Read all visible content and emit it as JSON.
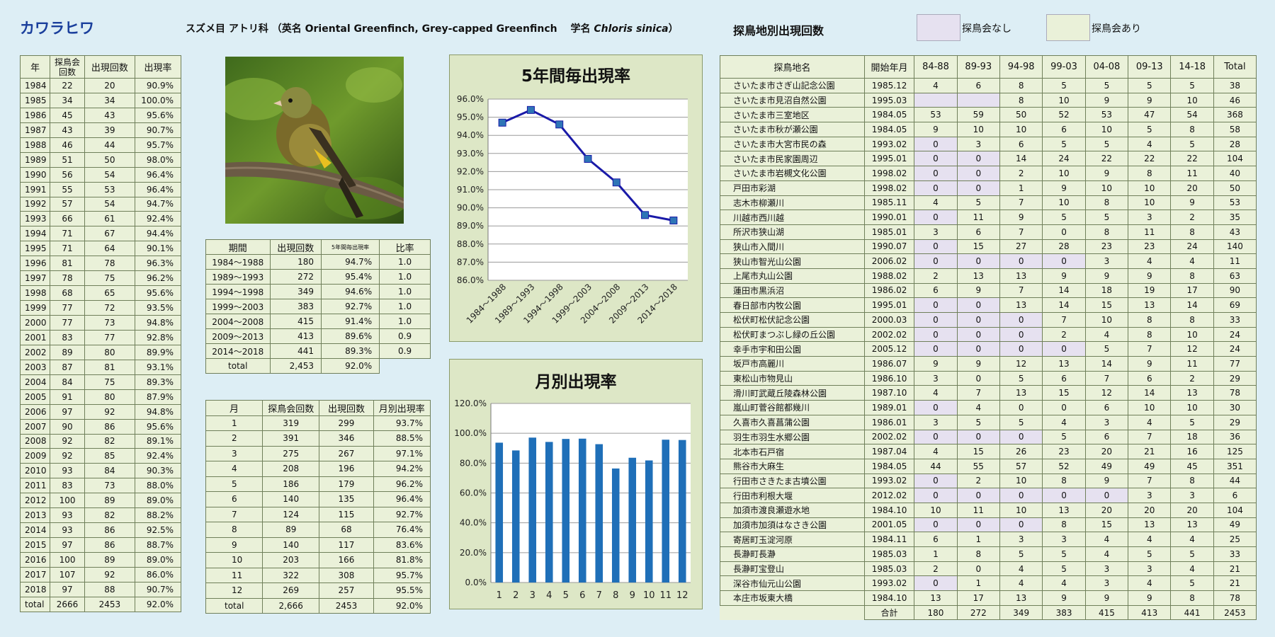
{
  "header": {
    "title": "カワラヒワ",
    "subtitle_pre": "スズメ目 アトリ科 （英名 Oriental Greenfinch, Grey-capped Greenfinch　 学名 ",
    "subtitle_sci": "Chloris sinica",
    "subtitle_post": "）",
    "sites_title": "探鳥地別出現回数",
    "legend_none": "探鳥会なし",
    "legend_some": "探鳥会あり"
  },
  "colors": {
    "no_meeting": "#e6e1f0",
    "meeting": "#eaf1d9",
    "line": "#1a1aa8",
    "marker": "#2e75b6",
    "bar": "#1f6fb8"
  },
  "year_table": {
    "headers": [
      "年",
      "探鳥会回数",
      "出現回数",
      "出現率"
    ],
    "rows": [
      [
        "1984",
        "22",
        "20",
        "90.9%"
      ],
      [
        "1985",
        "34",
        "34",
        "100.0%"
      ],
      [
        "1986",
        "45",
        "43",
        "95.6%"
      ],
      [
        "1987",
        "43",
        "39",
        "90.7%"
      ],
      [
        "1988",
        "46",
        "44",
        "95.7%"
      ],
      [
        "1989",
        "51",
        "50",
        "98.0%"
      ],
      [
        "1990",
        "56",
        "54",
        "96.4%"
      ],
      [
        "1991",
        "55",
        "53",
        "96.4%"
      ],
      [
        "1992",
        "57",
        "54",
        "94.7%"
      ],
      [
        "1993",
        "66",
        "61",
        "92.4%"
      ],
      [
        "1994",
        "71",
        "67",
        "94.4%"
      ],
      [
        "1995",
        "71",
        "64",
        "90.1%"
      ],
      [
        "1996",
        "81",
        "78",
        "96.3%"
      ],
      [
        "1997",
        "78",
        "75",
        "96.2%"
      ],
      [
        "1998",
        "68",
        "65",
        "95.6%"
      ],
      [
        "1999",
        "77",
        "72",
        "93.5%"
      ],
      [
        "2000",
        "77",
        "73",
        "94.8%"
      ],
      [
        "2001",
        "83",
        "77",
        "92.8%"
      ],
      [
        "2002",
        "89",
        "80",
        "89.9%"
      ],
      [
        "2003",
        "87",
        "81",
        "93.1%"
      ],
      [
        "2004",
        "84",
        "75",
        "89.3%"
      ],
      [
        "2005",
        "91",
        "80",
        "87.9%"
      ],
      [
        "2006",
        "97",
        "92",
        "94.8%"
      ],
      [
        "2007",
        "90",
        "86",
        "95.6%"
      ],
      [
        "2008",
        "92",
        "82",
        "89.1%"
      ],
      [
        "2009",
        "92",
        "85",
        "92.4%"
      ],
      [
        "2010",
        "93",
        "84",
        "90.3%"
      ],
      [
        "2011",
        "83",
        "73",
        "88.0%"
      ],
      [
        "2012",
        "100",
        "89",
        "89.0%"
      ],
      [
        "2013",
        "93",
        "82",
        "88.2%"
      ],
      [
        "2014",
        "93",
        "86",
        "92.5%"
      ],
      [
        "2015",
        "97",
        "86",
        "88.7%"
      ],
      [
        "2016",
        "100",
        "89",
        "89.0%"
      ],
      [
        "2017",
        "107",
        "92",
        "86.0%"
      ],
      [
        "2018",
        "97",
        "88",
        "90.7%"
      ],
      [
        "total",
        "2666",
        "2453",
        "92.0%"
      ]
    ]
  },
  "period_table": {
    "headers": [
      "期間",
      "出現回数",
      "5年間毎出現率",
      "比率"
    ],
    "rows": [
      [
        "1984～1988",
        "180",
        "94.7%",
        "1.0"
      ],
      [
        "1989～1993",
        "272",
        "95.4%",
        "1.0"
      ],
      [
        "1994～1998",
        "349",
        "94.6%",
        "1.0"
      ],
      [
        "1999～2003",
        "383",
        "92.7%",
        "1.0"
      ],
      [
        "2004～2008",
        "415",
        "91.4%",
        "1.0"
      ],
      [
        "2009～2013",
        "413",
        "89.6%",
        "0.9"
      ],
      [
        "2014～2018",
        "441",
        "89.3%",
        "0.9"
      ]
    ],
    "total": [
      "total",
      "2,453",
      "92.0%"
    ]
  },
  "month_table": {
    "headers": [
      "月",
      "探鳥会回数",
      "出現回数",
      "月別出現率"
    ],
    "rows": [
      [
        "1",
        "319",
        "299",
        "93.7%"
      ],
      [
        "2",
        "391",
        "346",
        "88.5%"
      ],
      [
        "3",
        "275",
        "267",
        "97.1%"
      ],
      [
        "4",
        "208",
        "196",
        "94.2%"
      ],
      [
        "5",
        "186",
        "179",
        "96.2%"
      ],
      [
        "6",
        "140",
        "135",
        "96.4%"
      ],
      [
        "7",
        "124",
        "115",
        "92.7%"
      ],
      [
        "8",
        "89",
        "68",
        "76.4%"
      ],
      [
        "9",
        "140",
        "117",
        "83.6%"
      ],
      [
        "10",
        "203",
        "166",
        "81.8%"
      ],
      [
        "11",
        "322",
        "308",
        "95.7%"
      ],
      [
        "12",
        "269",
        "257",
        "95.5%"
      ],
      [
        "total",
        "2,666",
        "2453",
        "92.0%"
      ]
    ]
  },
  "chart_data": [
    {
      "type": "line",
      "title": "5年間毎出現率",
      "categories": [
        "1984～1988",
        "1989～1993",
        "1994～1998",
        "1999～2003",
        "2004～2008",
        "2009～2013",
        "2014～2018"
      ],
      "values": [
        94.7,
        95.4,
        94.6,
        92.7,
        91.4,
        89.6,
        89.3
      ],
      "ylim": [
        86,
        96
      ],
      "yticks": [
        "86.0%",
        "87.0%",
        "88.0%",
        "89.0%",
        "90.0%",
        "91.0%",
        "92.0%",
        "93.0%",
        "94.0%",
        "95.0%",
        "96.0%"
      ],
      "grid": true
    },
    {
      "type": "bar",
      "title": "月別出現率",
      "categories": [
        "1",
        "2",
        "3",
        "4",
        "5",
        "6",
        "7",
        "8",
        "9",
        "10",
        "11",
        "12"
      ],
      "values": [
        93.7,
        88.5,
        97.1,
        94.2,
        96.2,
        96.4,
        92.7,
        76.4,
        83.6,
        81.8,
        95.7,
        95.5
      ],
      "ylim": [
        0,
        120
      ],
      "yticks": [
        "0.0%",
        "20.0%",
        "40.0%",
        "60.0%",
        "80.0%",
        "100.0%",
        "120.0%"
      ],
      "grid": true
    }
  ],
  "sites_table": {
    "headers": [
      "探鳥地名",
      "開始年月",
      "84-88",
      "89-93",
      "94-98",
      "99-03",
      "04-08",
      "09-13",
      "14-18",
      "Total"
    ],
    "rows": [
      {
        "name": "さいたま市さぎ山記念公園",
        "start": "1985.12",
        "v": [
          "4",
          "6",
          "8",
          "5",
          "5",
          "5",
          "5"
        ],
        "total": "38",
        "na": []
      },
      {
        "name": "さいたま市見沼自然公園",
        "start": "1995.03",
        "v": [
          "",
          "",
          "8",
          "10",
          "9",
          "9",
          "10"
        ],
        "total": "46",
        "na": [
          0,
          1
        ]
      },
      {
        "name": "さいたま市三室地区",
        "start": "1984.05",
        "v": [
          "53",
          "59",
          "50",
          "52",
          "53",
          "47",
          "54"
        ],
        "total": "368",
        "na": []
      },
      {
        "name": "さいたま市秋が瀬公園",
        "start": "1984.05",
        "v": [
          "9",
          "10",
          "10",
          "6",
          "10",
          "5",
          "8"
        ],
        "total": "58",
        "na": []
      },
      {
        "name": "さいたま市大宮市民の森",
        "start": "1993.02",
        "v": [
          "0",
          "3",
          "6",
          "5",
          "5",
          "4",
          "5"
        ],
        "total": "28",
        "na": [
          0
        ]
      },
      {
        "name": "さいたま市民家園周辺",
        "start": "1995.01",
        "v": [
          "0",
          "0",
          "14",
          "24",
          "22",
          "22",
          "22"
        ],
        "total": "104",
        "na": [
          0,
          1
        ]
      },
      {
        "name": "さいたま市岩槻文化公園",
        "start": "1998.02",
        "v": [
          "0",
          "0",
          "2",
          "10",
          "9",
          "8",
          "11"
        ],
        "total": "40",
        "na": [
          0,
          1
        ]
      },
      {
        "name": "戸田市彩湖",
        "start": "1998.02",
        "v": [
          "0",
          "0",
          "1",
          "9",
          "10",
          "10",
          "20"
        ],
        "total": "50",
        "na": [
          0,
          1
        ]
      },
      {
        "name": "志木市柳瀬川",
        "start": "1985.11",
        "v": [
          "4",
          "5",
          "7",
          "10",
          "8",
          "10",
          "9"
        ],
        "total": "53",
        "na": []
      },
      {
        "name": "川越市西川越",
        "start": "1990.01",
        "v": [
          "0",
          "11",
          "9",
          "5",
          "5",
          "3",
          "2"
        ],
        "total": "35",
        "na": [
          0
        ]
      },
      {
        "name": "所沢市狭山湖",
        "start": "1985.01",
        "v": [
          "3",
          "6",
          "7",
          "0",
          "8",
          "11",
          "8"
        ],
        "total": "43",
        "na": []
      },
      {
        "name": "狭山市入間川",
        "start": "1990.07",
        "v": [
          "0",
          "15",
          "27",
          "28",
          "23",
          "23",
          "24"
        ],
        "total": "140",
        "na": [
          0
        ]
      },
      {
        "name": "狭山市智光山公園",
        "start": "2006.02",
        "v": [
          "0",
          "0",
          "0",
          "0",
          "3",
          "4",
          "4"
        ],
        "total": "11",
        "na": [
          0,
          1,
          2,
          3
        ]
      },
      {
        "name": "上尾市丸山公園",
        "start": "1988.02",
        "v": [
          "2",
          "13",
          "13",
          "9",
          "9",
          "9",
          "8"
        ],
        "total": "63",
        "na": []
      },
      {
        "name": "蓮田市黒浜沼",
        "start": "1986.02",
        "v": [
          "6",
          "9",
          "7",
          "14",
          "18",
          "19",
          "17"
        ],
        "total": "90",
        "na": []
      },
      {
        "name": "春日部市内牧公園",
        "start": "1995.01",
        "v": [
          "0",
          "0",
          "13",
          "14",
          "15",
          "13",
          "14"
        ],
        "total": "69",
        "na": [
          0,
          1
        ]
      },
      {
        "name": "松伏町松伏記念公園",
        "start": "2000.03",
        "v": [
          "0",
          "0",
          "0",
          "7",
          "10",
          "8",
          "8"
        ],
        "total": "33",
        "na": [
          0,
          1,
          2
        ]
      },
      {
        "name": "松伏町まつぶし緑の丘公園",
        "start": "2002.02",
        "v": [
          "0",
          "0",
          "0",
          "2",
          "4",
          "8",
          "10"
        ],
        "total": "24",
        "na": [
          0,
          1,
          2
        ]
      },
      {
        "name": "幸手市宇和田公園",
        "start": "2005.12",
        "v": [
          "0",
          "0",
          "0",
          "0",
          "5",
          "7",
          "12"
        ],
        "total": "24",
        "na": [
          0,
          1,
          2,
          3
        ]
      },
      {
        "name": "坂戸市高麗川",
        "start": "1986.07",
        "v": [
          "9",
          "9",
          "12",
          "13",
          "14",
          "9",
          "11"
        ],
        "total": "77",
        "na": []
      },
      {
        "name": "東松山市物見山",
        "start": "1986.10",
        "v": [
          "3",
          "0",
          "5",
          "6",
          "7",
          "6",
          "2"
        ],
        "total": "29",
        "na": []
      },
      {
        "name": "滑川町武蔵丘陵森林公園",
        "start": "1987.10",
        "v": [
          "4",
          "7",
          "13",
          "15",
          "12",
          "14",
          "13"
        ],
        "total": "78",
        "na": []
      },
      {
        "name": "嵐山町菅谷館都幾川",
        "start": "1989.01",
        "v": [
          "0",
          "4",
          "0",
          "0",
          "6",
          "10",
          "10"
        ],
        "total": "30",
        "na": [
          0
        ]
      },
      {
        "name": "久喜市久喜菖蒲公園",
        "start": "1986.01",
        "v": [
          "3",
          "5",
          "5",
          "4",
          "3",
          "4",
          "5"
        ],
        "total": "29",
        "na": []
      },
      {
        "name": "羽生市羽生水郷公園",
        "start": "2002.02",
        "v": [
          "0",
          "0",
          "0",
          "5",
          "6",
          "7",
          "18"
        ],
        "total": "36",
        "na": [
          0,
          1,
          2
        ]
      },
      {
        "name": "北本市石戸宿",
        "start": "1987.04",
        "v": [
          "4",
          "15",
          "26",
          "23",
          "20",
          "21",
          "16"
        ],
        "total": "125",
        "na": []
      },
      {
        "name": "熊谷市大麻生",
        "start": "1984.05",
        "v": [
          "44",
          "55",
          "57",
          "52",
          "49",
          "49",
          "45"
        ],
        "total": "351",
        "na": []
      },
      {
        "name": "行田市さきたま古墳公園",
        "start": "1993.02",
        "v": [
          "0",
          "2",
          "10",
          "8",
          "9",
          "7",
          "8"
        ],
        "total": "44",
        "na": [
          0
        ]
      },
      {
        "name": "行田市利根大堰",
        "start": "2012.02",
        "v": [
          "0",
          "0",
          "0",
          "0",
          "0",
          "3",
          "3"
        ],
        "total": "6",
        "na": [
          0,
          1,
          2,
          3,
          4
        ]
      },
      {
        "name": "加須市渡良瀬遊水地",
        "start": "1984.10",
        "v": [
          "10",
          "11",
          "10",
          "13",
          "20",
          "20",
          "20"
        ],
        "total": "104",
        "na": []
      },
      {
        "name": "加須市加須はなさき公園",
        "start": "2001.05",
        "v": [
          "0",
          "0",
          "0",
          "8",
          "15",
          "13",
          "13"
        ],
        "total": "49",
        "na": [
          0,
          1,
          2
        ]
      },
      {
        "name": "寄居町玉淀河原",
        "start": "1984.11",
        "v": [
          "6",
          "1",
          "3",
          "3",
          "4",
          "4",
          "4"
        ],
        "total": "25",
        "na": []
      },
      {
        "name": "長瀞町長瀞",
        "start": "1985.03",
        "v": [
          "1",
          "8",
          "5",
          "5",
          "4",
          "5",
          "5"
        ],
        "total": "33",
        "na": []
      },
      {
        "name": "長瀞町宝登山",
        "start": "1985.03",
        "v": [
          "2",
          "0",
          "4",
          "5",
          "3",
          "3",
          "4"
        ],
        "total": "21",
        "na": []
      },
      {
        "name": "深谷市仙元山公園",
        "start": "1993.02",
        "v": [
          "0",
          "1",
          "4",
          "4",
          "3",
          "4",
          "5"
        ],
        "total": "21",
        "na": [
          0
        ]
      },
      {
        "name": "本庄市坂東大橋",
        "start": "1984.10",
        "v": [
          "13",
          "17",
          "13",
          "9",
          "9",
          "9",
          "8"
        ],
        "total": "78",
        "na": []
      }
    ],
    "sum_label": "合計",
    "sums": [
      "180",
      "272",
      "349",
      "383",
      "415",
      "413",
      "441",
      "2453"
    ]
  }
}
